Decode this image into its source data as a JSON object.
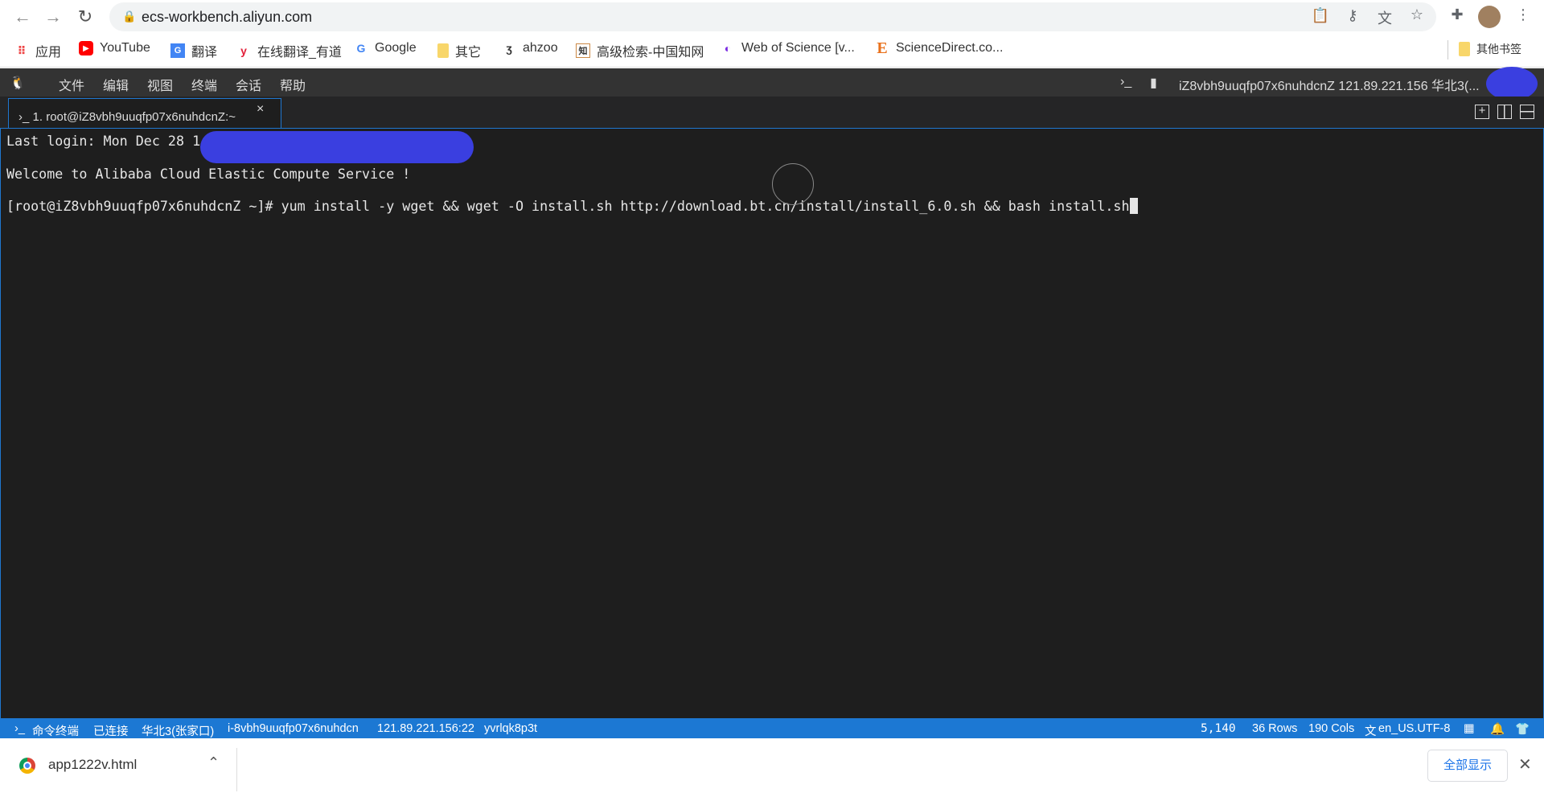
{
  "browser": {
    "url": "ecs-workbench.aliyun.com",
    "bookmarks": [
      {
        "label": "应用",
        "icon": "apps-grid-icon"
      },
      {
        "label": "YouTube",
        "icon": "youtube-icon"
      },
      {
        "label": "翻译",
        "icon": "translate-icon"
      },
      {
        "label": "在线翻译_有道",
        "icon": "youdao-icon"
      },
      {
        "label": "Google",
        "icon": "google-icon"
      },
      {
        "label": "其它",
        "icon": "folder-icon"
      },
      {
        "label": "ahzoo",
        "icon": "ahzoo-icon"
      },
      {
        "label": "高级检索-中国知网",
        "icon": "cnki-icon"
      },
      {
        "label": "Web of Science [v...",
        "icon": "wos-icon"
      },
      {
        "label": "ScienceDirect.co...",
        "icon": "elsevier-icon"
      }
    ],
    "other_bookmarks": "其他书签"
  },
  "menu": {
    "items": [
      "文件",
      "编辑",
      "视图",
      "终端",
      "会话",
      "帮助"
    ],
    "instance_info": "iZ8vbh9uuqfp07x6nuhdcnZ 121.89.221.156 华北3(..."
  },
  "tab": {
    "label": "1. root@iZ8vbh9uuqfp07x6nuhdcnZ:~",
    "close": "×"
  },
  "terminal": {
    "lines": [
      "Last login: Mon Dec 28 1",
      "Welcome to Alibaba Cloud Elastic Compute Service !",
      "[root@iZ8vbh9uuqfp07x6nuhdcnZ ~]# yum install -y wget && wget -O install.sh http://download.bt.cn/install/install_6.0.sh && bash install.sh"
    ]
  },
  "status": {
    "terminal": "命令终端",
    "connected": "已连接",
    "region": "华北3(张家口)",
    "instance": "i-8vbh9uuqfp07x6nuhdcn",
    "address": "121.89.221.156:22",
    "session": "yvrlqk8p3t",
    "cursor": "5,140",
    "rows": "36 Rows",
    "cols": "190 Cols",
    "encoding": "en_US.UTF-8"
  },
  "download": {
    "file": "app1222v.html",
    "show_all": "全部显示"
  },
  "colors": {
    "accent": "#1c78d3",
    "terminal_bg": "#1e1e1e",
    "redaction": "#3a3fe0"
  }
}
